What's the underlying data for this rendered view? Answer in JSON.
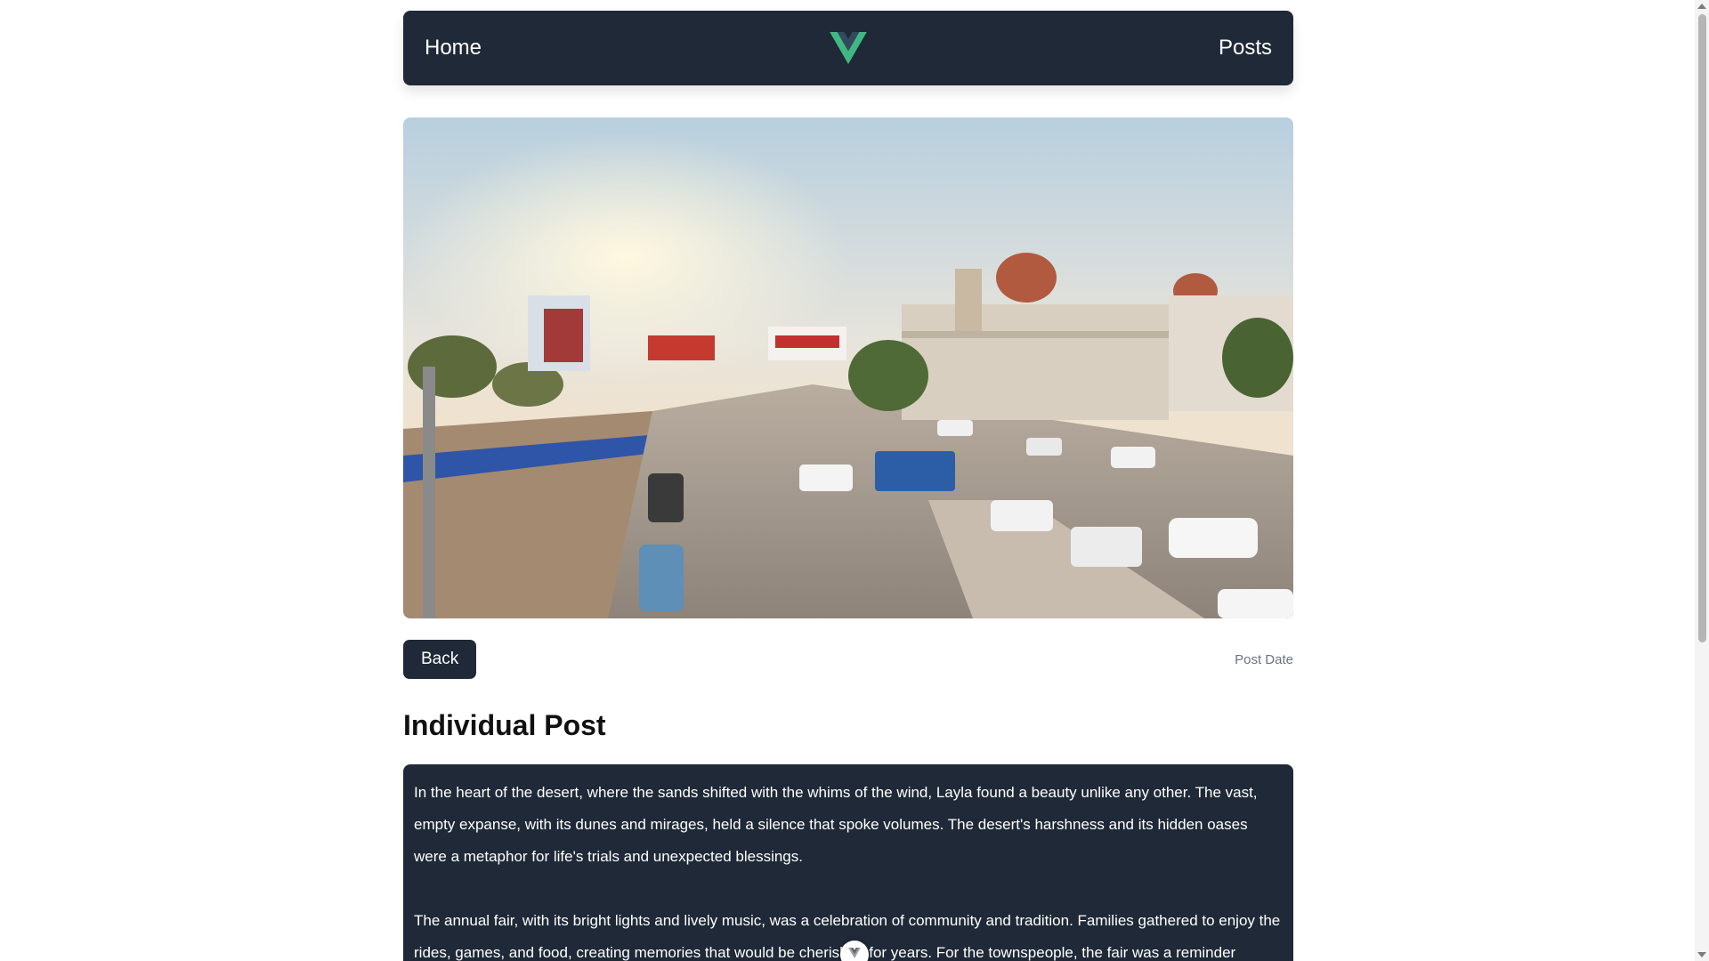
{
  "nav": {
    "home_label": "Home",
    "posts_label": "Posts",
    "logo_icon": "vue-logo-icon",
    "logo_colors": {
      "outer": "#41b883",
      "inner": "#35495e"
    }
  },
  "hero": {
    "image_icon": "city-street-photo"
  },
  "post": {
    "back_label": "Back",
    "date_label": "Post Date",
    "title": "Individual Post",
    "paragraphs": [
      "In the heart of the desert, where the sands shifted with the whims of the wind, Layla found a beauty unlike any other. The vast, empty expanse, with its dunes and mirages, held a silence that spoke volumes. The desert's harshness and its hidden oases were a metaphor for life's trials and unexpected blessings.",
      "The annual fair, with its bright lights and lively music, was a celebration of community and tradition. Families gathered to enjoy the rides, games, and food, creating memories that would be cherished for years. For the townspeople, the fair was a reminder"
    ]
  },
  "colors": {
    "navbar_bg": "#1f2937",
    "content_bg": "#1f2937",
    "button_bg": "#1f2937",
    "muted_text": "#6b7280"
  }
}
